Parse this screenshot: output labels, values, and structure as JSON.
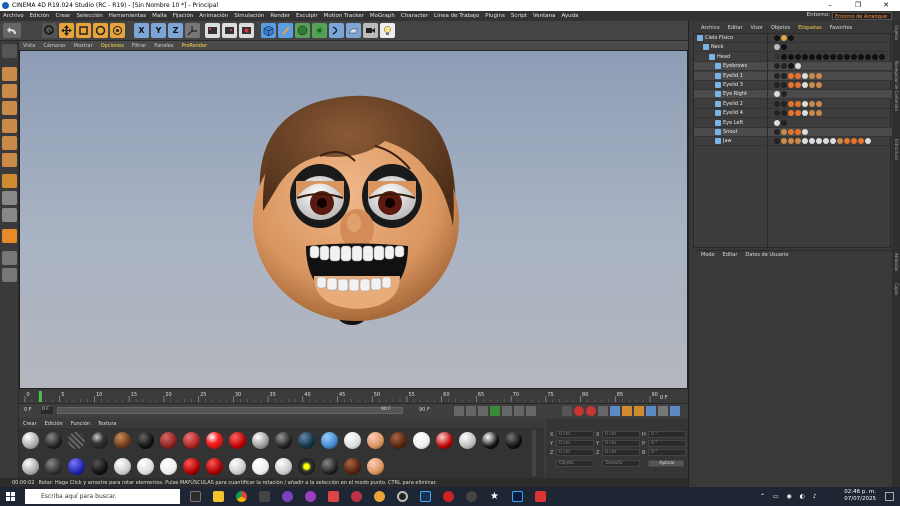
{
  "window": {
    "title": "CINEMA 4D R19.024 Studio (RC - R19) - [Sin Nombre 10 *] - Principal",
    "min": "–",
    "max": "❐",
    "close": "✕"
  },
  "menubar": [
    "Archivo",
    "Edición",
    "Crear",
    "Selección",
    "Herramientas",
    "Malla",
    "Fijación",
    "Animación",
    "Simulación",
    "Render",
    "Esculpir",
    "Motion Tracker",
    "MoGraph",
    "Character",
    "Línea de Trabajo",
    "Plugins",
    "Script",
    "Ventana",
    "Ayuda"
  ],
  "environment": {
    "label": "Entorno:",
    "value": "Entorno de Arranque"
  },
  "toolbar": {
    "x": "X",
    "y": "Y",
    "z": "Z"
  },
  "viewport": {
    "menu": [
      "Vista",
      "Cámaras",
      "Mostrar",
      "Opciones",
      "Filtrar",
      "Paneles",
      "ProRender"
    ]
  },
  "timeline": {
    "ticks": [
      "0",
      "5",
      "10",
      "15",
      "20",
      "25",
      "30",
      "35",
      "40",
      "45",
      "50",
      "55",
      "60",
      "65",
      "70",
      "75",
      "80",
      "85",
      "90"
    ],
    "end_label": "0 F",
    "current": "0 F",
    "start": "0 F",
    "range_end": "90 F",
    "max_frame": "90 F"
  },
  "materials": {
    "menu": [
      "Crear",
      "Edición",
      "Función",
      "Textura"
    ]
  },
  "coords": {
    "x": "X",
    "y": "Y",
    "z": "Z",
    "h": "H",
    "p": "P",
    "b": "B",
    "val": "0 cm",
    "ang": "0 °",
    "sys": "Objeto",
    "size": "Tamaño",
    "apply": "Aplicar"
  },
  "status": {
    "time": "00:00:02",
    "message": "Rotar: Haga Click y arrastre para rotar elementos. Pulse MAYÚSCULAS para cuantificar la rotación / añadir a la selección en el modo punto. CTRL para eliminar."
  },
  "objects": {
    "menu": [
      "Archivo",
      "Editar",
      "Visor",
      "Objetos",
      "Etiquetas",
      "Favoritos"
    ],
    "rows": [
      {
        "name": "Cielo Físico",
        "indent": 0,
        "sel": false
      },
      {
        "name": "Neck",
        "indent": 1,
        "sel": false
      },
      {
        "name": "Head",
        "indent": 2,
        "sel": false
      },
      {
        "name": "Eyebrows",
        "indent": 3,
        "sel": true
      },
      {
        "name": "Eyelid 1",
        "indent": 3,
        "sel": true
      },
      {
        "name": "Eyelid 3",
        "indent": 3,
        "sel": false
      },
      {
        "name": "Eye Right",
        "indent": 3,
        "sel": true
      },
      {
        "name": "Eyelid 2",
        "indent": 3,
        "sel": false
      },
      {
        "name": "Eyelid 4",
        "indent": 3,
        "sel": false
      },
      {
        "name": "Eye Left",
        "indent": 3,
        "sel": false
      },
      {
        "name": "Snout",
        "indent": 3,
        "sel": true
      },
      {
        "name": "Jaw",
        "indent": 3,
        "sel": false
      }
    ]
  },
  "attributes": {
    "menu": [
      "Modo",
      "Editar",
      "Datos de Usuario"
    ]
  },
  "sidetabs": [
    "Objetos",
    "Navegador de Contenido",
    "Estructura",
    "Atributos",
    "Capas"
  ],
  "taskbar": {
    "search_placeholder": "Escriba aquí para buscar.",
    "time": "02:46 p. m.",
    "date": "07/07/2025"
  },
  "colors": {
    "accent": "#ffd84a",
    "skin": "#e8a070",
    "hair": "#6b4528"
  }
}
